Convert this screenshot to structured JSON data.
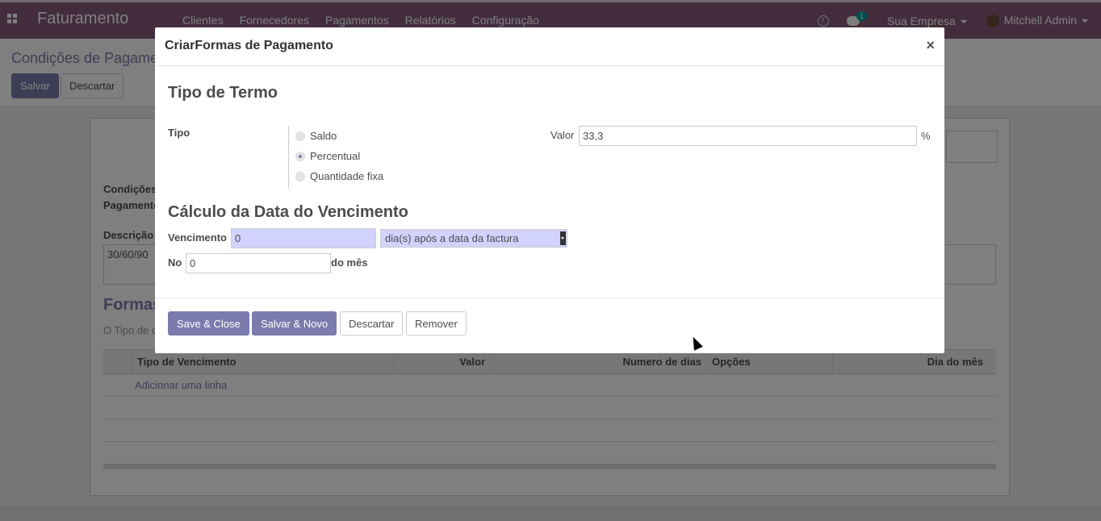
{
  "navbar": {
    "brand": "Faturamento",
    "menu": [
      "Clientes",
      "Fornecedores",
      "Pagamentos",
      "Relatórios",
      "Configuração"
    ],
    "chat_badge": "1",
    "company": "Sua Empresa",
    "user": "Mitchell Admin"
  },
  "control_panel": {
    "breadcrumb": "Condições de Pagamento",
    "save_label": "Salvar",
    "discard_label": "Descartar"
  },
  "form_bg": {
    "label_conditions_1": "Condições",
    "label_conditions_2": "Pagamento",
    "label_description": "Descrição",
    "description_value": "30/60/90",
    "section_title": "Formas de Pagamento",
    "hint": "O Tipo de condição de pagamento",
    "table_headers": [
      "Tipo de Vencimento",
      "Valor",
      "Numero de dias",
      "Opções",
      "Dia do mês"
    ],
    "add_line": "Adicionar uma linha"
  },
  "modal": {
    "title": "CriarFormas de Pagamento",
    "close": "×",
    "section_term": "Tipo de Termo",
    "tipo_label": "Tipo",
    "radio_options": [
      "Saldo",
      "Percentual",
      "Quantidade fixa"
    ],
    "radio_selected": "Percentual",
    "valor_label": "Valor",
    "valor_value": "33,3",
    "valor_unit": "%",
    "section_due": "Cálculo da Data do Vencimento",
    "vencimento_label": "Vencimento",
    "vencimento_value": "0",
    "vencimento_option": "dia(s) após a data da factura",
    "no_label": "No",
    "no_value": "0",
    "do_mes_label": "do mês",
    "buttons": {
      "save_close": "Save & Close",
      "save_new": "Salvar & Novo",
      "discard": "Descartar",
      "remove": "Remover"
    }
  },
  "colors": {
    "brand": "#875a7b",
    "primary": "#7c7bad",
    "required_field": "#d2d2ff"
  }
}
